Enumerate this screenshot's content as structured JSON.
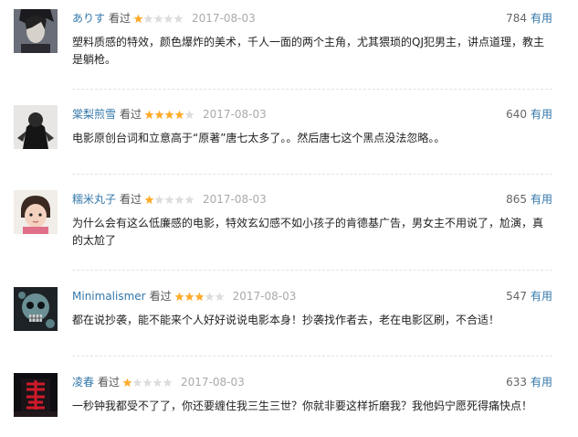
{
  "reviews": [
    {
      "user": "ありす",
      "status": "看过",
      "rating": 1,
      "date": "2017-08-03",
      "votes": "784",
      "useful": "有用",
      "content": "塑料质感的特效，颜色爆炸的美术，千人一面的两个主角，尤其猥琐的QJ犯男主，讲点道理，教主是躺枪。"
    },
    {
      "user": "棠梨煎雪",
      "status": "看过",
      "rating": 4,
      "date": "2017-08-03",
      "votes": "640",
      "useful": "有用",
      "content": "电影原创台词和立意高于“原著”唐七太多了。。然后唐七这个黑点没法忽略。。"
    },
    {
      "user": "糯米丸子",
      "status": "看过",
      "rating": 1,
      "date": "2017-08-03",
      "votes": "865",
      "useful": "有用",
      "content": "为什么会有这么低廉感的电影，特效玄幻感不如小孩子的肯德基广告，男女主不用说了，尬演，真的太尬了"
    },
    {
      "user": "Minimalismer",
      "status": "看过",
      "rating": 3,
      "date": "2017-08-03",
      "votes": "547",
      "useful": "有用",
      "content": "都在说抄袭，能不能来个人好好说说电影本身！抄袭找作者去，老在电影区刷，不合适！"
    },
    {
      "user": "凌春",
      "status": "看过",
      "rating": 1,
      "date": "2017-08-03",
      "votes": "633",
      "useful": "有用",
      "content": "一秒钟我都受不了了，你还要缠住我三生三世？你就非要这样折磨我？我他妈宁愿死得痛快点！"
    }
  ],
  "colors": {
    "link": "#3377aa",
    "star_on": "#ffac2d",
    "star_off": "#dddddd",
    "date": "#aaaaaa"
  },
  "icons": {
    "star": "star-icon",
    "avatar": "avatar"
  }
}
